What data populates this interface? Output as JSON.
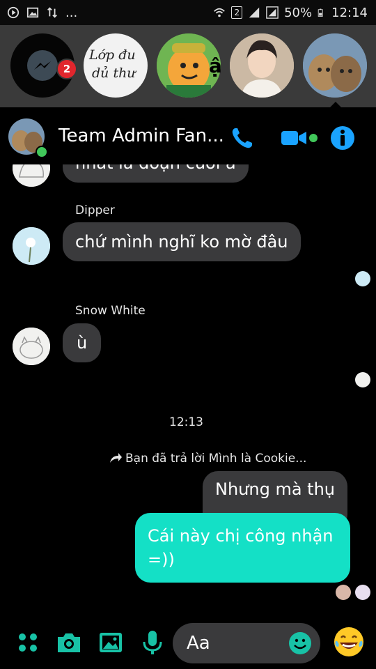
{
  "status_bar": {
    "left_icons": [
      "play-icon",
      "image-icon",
      "data-arrows-icon"
    ],
    "overflow": "...",
    "sim": "2",
    "battery_percent": "50%",
    "time": "12:14"
  },
  "stories": {
    "messenger_badge": "2",
    "items": [
      {
        "name": "Lớp du dủ thư",
        "text_line1": "Lớp đu",
        "text_line2": "dủ thư"
      }
    ]
  },
  "chat": {
    "title": "Team Admin Fan...",
    "messages": [
      {
        "type": "in",
        "text": "nhất là đoạn cuối á"
      },
      {
        "type": "sender",
        "text": "Dipper"
      },
      {
        "type": "in",
        "text": "chứ mình nghĩ ko mờ đâu"
      },
      {
        "type": "sender",
        "text": "Snow White"
      },
      {
        "type": "in",
        "text": "ù"
      },
      {
        "type": "time",
        "text": "12:13"
      },
      {
        "type": "reply_note",
        "text": "Bạn đã trả lời Mình là Cookie..."
      },
      {
        "type": "out_quoted",
        "text": "Nhưng mà thụ"
      },
      {
        "type": "out",
        "text": "Cái này chị công nhận =))"
      }
    ]
  },
  "composer": {
    "placeholder": "Aa"
  },
  "colors": {
    "accent": "#1aa3ff",
    "teal_bubble": "#14e0c6",
    "composer_icon": "#18c2a6",
    "online": "#41c75a",
    "badge": "#e1262d"
  }
}
